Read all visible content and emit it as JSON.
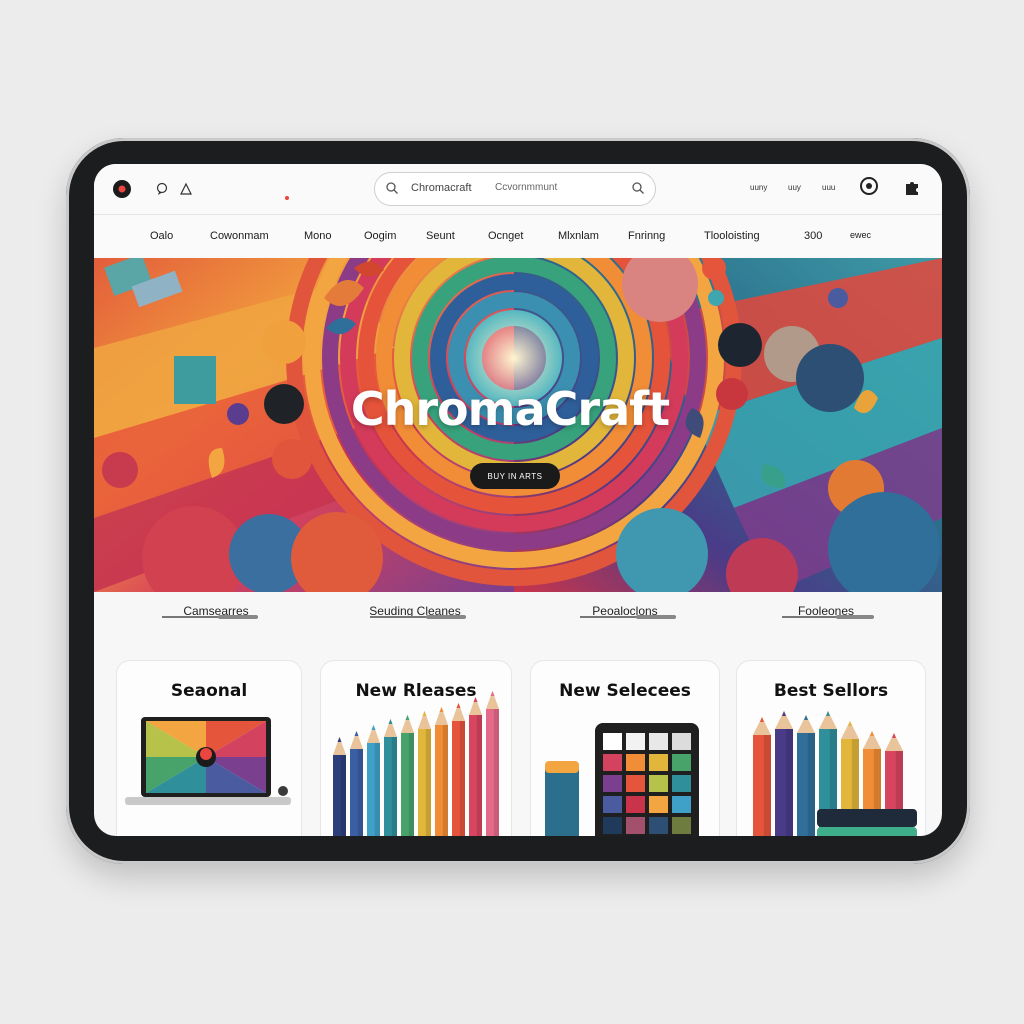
{
  "topbar": {
    "search_text": "Chromacraft",
    "search_hint": "Ccvornmmunt",
    "right_links": [
      "uuny",
      "uuy",
      "uuu"
    ]
  },
  "nav": {
    "items": [
      "Oalo",
      "Cowonmam",
      "Mono",
      "Oogim",
      "Seunt",
      "Ocnget",
      "Mlxnlam",
      "Fnrinng",
      "Tlooloisting",
      "300",
      "ewec"
    ]
  },
  "hero": {
    "title": "ChromaCraft",
    "button_label": "BUY IN ARTS"
  },
  "sections": {
    "tabs": [
      "Camsearres",
      "Seuding Cleanes",
      "Peoaloclons",
      "Fooleones"
    ]
  },
  "cards": [
    {
      "title": "Seaonal"
    },
    {
      "title": "New Rleases"
    },
    {
      "title": "New Selecees"
    },
    {
      "title": "Best Sellors"
    }
  ],
  "colors": {
    "accent_red": "#e8463f",
    "accent_orange": "#f29a3a",
    "accent_teal": "#2f8f9b",
    "accent_purple": "#5b3d8f",
    "dark": "#1a1a1a"
  },
  "icons": [
    "record-icon",
    "chat-icon",
    "alert-icon",
    "search-icon",
    "target-icon",
    "puzzle-icon"
  ]
}
